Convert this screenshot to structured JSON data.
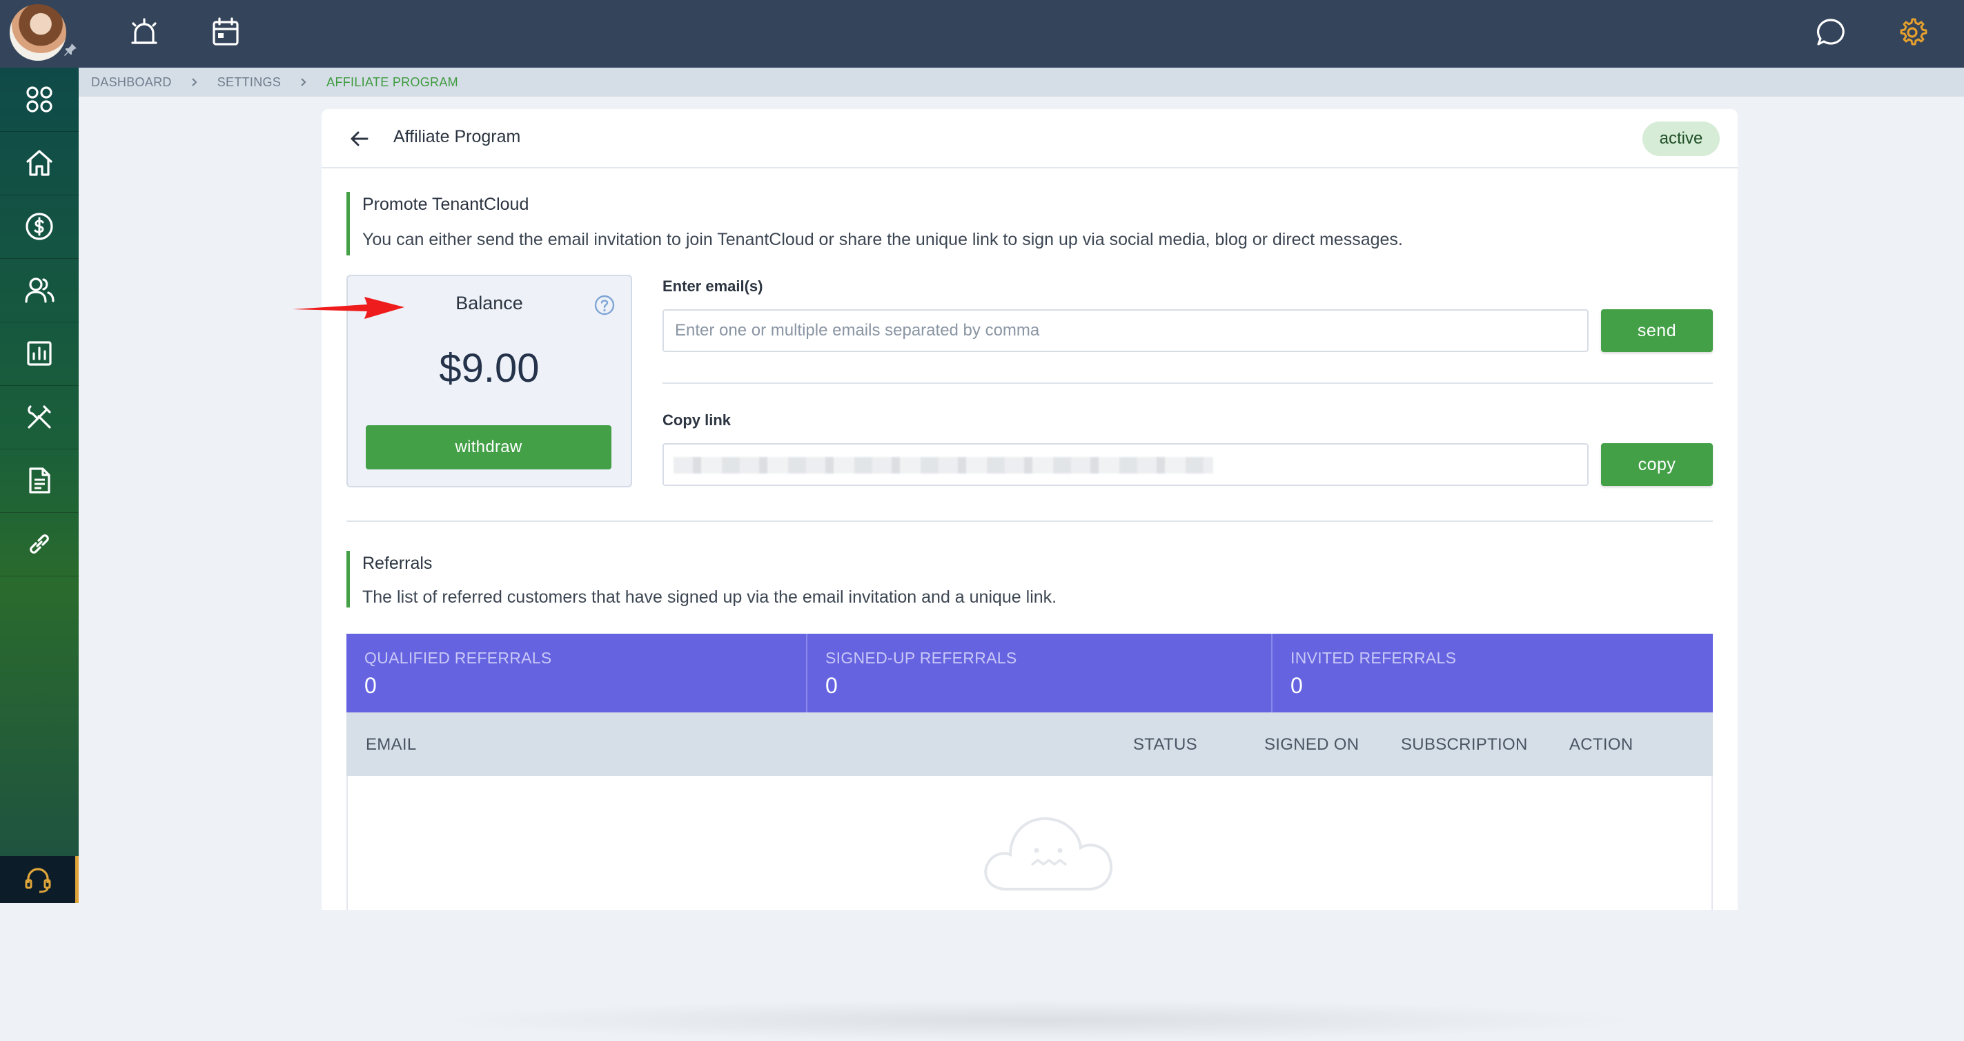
{
  "colors": {
    "topbar": "#34445a",
    "accent_green": "#43a047",
    "breadcrumb_active": "#3e9b3e",
    "stats_bg": "#6563e0",
    "settings_icon": "#e6a02e"
  },
  "topbar": {
    "icons": [
      "avatar",
      "alarm-icon",
      "calendar-icon",
      "chat-icon",
      "gear-icon"
    ]
  },
  "sidebar": {
    "items": [
      {
        "icon": "apps-grid-icon"
      },
      {
        "icon": "home-icon"
      },
      {
        "icon": "dollar-icon"
      },
      {
        "icon": "users-icon"
      },
      {
        "icon": "reports-icon"
      },
      {
        "icon": "tools-icon"
      },
      {
        "icon": "document-icon"
      },
      {
        "icon": "link-icon"
      }
    ],
    "support_icon": "headset-icon"
  },
  "breadcrumb": {
    "items": [
      "DASHBOARD",
      "SETTINGS",
      "AFFILIATE PROGRAM"
    ]
  },
  "header": {
    "title": "Affiliate Program",
    "status": "active"
  },
  "promote": {
    "title": "Promote TenantCloud",
    "description": "You can either send the email invitation to join TenantCloud or share the unique link to sign up via social media, blog or direct messages."
  },
  "balance": {
    "title": "Balance",
    "amount": "$9.00",
    "withdraw_label": "withdraw"
  },
  "email_invite": {
    "label": "Enter email(s)",
    "placeholder": "Enter one or multiple emails separated by comma",
    "value": "",
    "send_label": "send"
  },
  "copy_link": {
    "label": "Copy link",
    "copy_label": "copy"
  },
  "referrals": {
    "title": "Referrals",
    "description": "The list of referred customers that have signed up via the email invitation and a unique link.",
    "stats": [
      {
        "label": "QUALIFIED REFERRALS",
        "value": "0"
      },
      {
        "label": "SIGNED-UP REFERRALS",
        "value": "0"
      },
      {
        "label": "INVITED REFERRALS",
        "value": "0"
      }
    ],
    "columns": [
      "EMAIL",
      "STATUS",
      "SIGNED ON",
      "SUBSCRIPTION",
      "ACTION"
    ],
    "rows": []
  }
}
